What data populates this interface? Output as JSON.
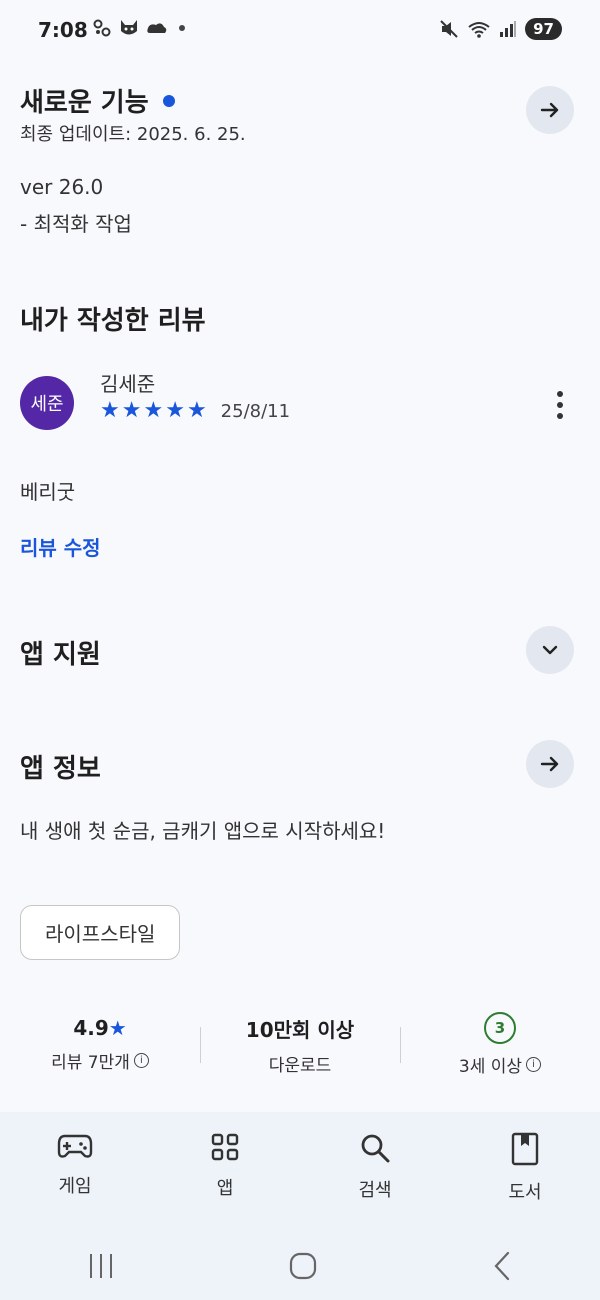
{
  "status_bar": {
    "time": "7:08",
    "battery": "97",
    "icons_left": [
      "link-icon",
      "cat-icon",
      "cloud-icon",
      "dot-icon"
    ],
    "icons_right": [
      "mute-icon",
      "wifi-icon",
      "signal-icon"
    ]
  },
  "whats_new": {
    "title": "새로운 기능",
    "updated": "최종 업데이트: 2025. 6. 25.",
    "version": "ver 26.0",
    "note": "- 최적화 작업"
  },
  "my_review": {
    "title": "내가 작성한 리뷰",
    "avatar_text": "세준",
    "author": "김세준",
    "rating": 5,
    "date": "25/8/11",
    "text": "베리굿",
    "edit_label": "리뷰 수정"
  },
  "app_support": {
    "title": "앱 지원"
  },
  "app_info": {
    "title": "앱 정보",
    "description": "내 생애 첫 순금, 금캐기 앱으로 시작하세요!",
    "category": "라이프스타일"
  },
  "stats": {
    "rating": "4.9",
    "reviews": "리뷰 7만개",
    "downloads": "10만회 이상",
    "downloads_label": "다운로드",
    "age_badge": "3",
    "age_label": "3세 이상"
  },
  "bottom_nav": [
    {
      "label": "게임",
      "icon": "gamepad-icon"
    },
    {
      "label": "앱",
      "icon": "apps-grid-icon"
    },
    {
      "label": "검색",
      "icon": "search-icon"
    },
    {
      "label": "도서",
      "icon": "book-icon"
    }
  ],
  "colors": {
    "accent": "#1a56db",
    "avatar": "#5327a5",
    "age_green": "#2e7d32"
  }
}
